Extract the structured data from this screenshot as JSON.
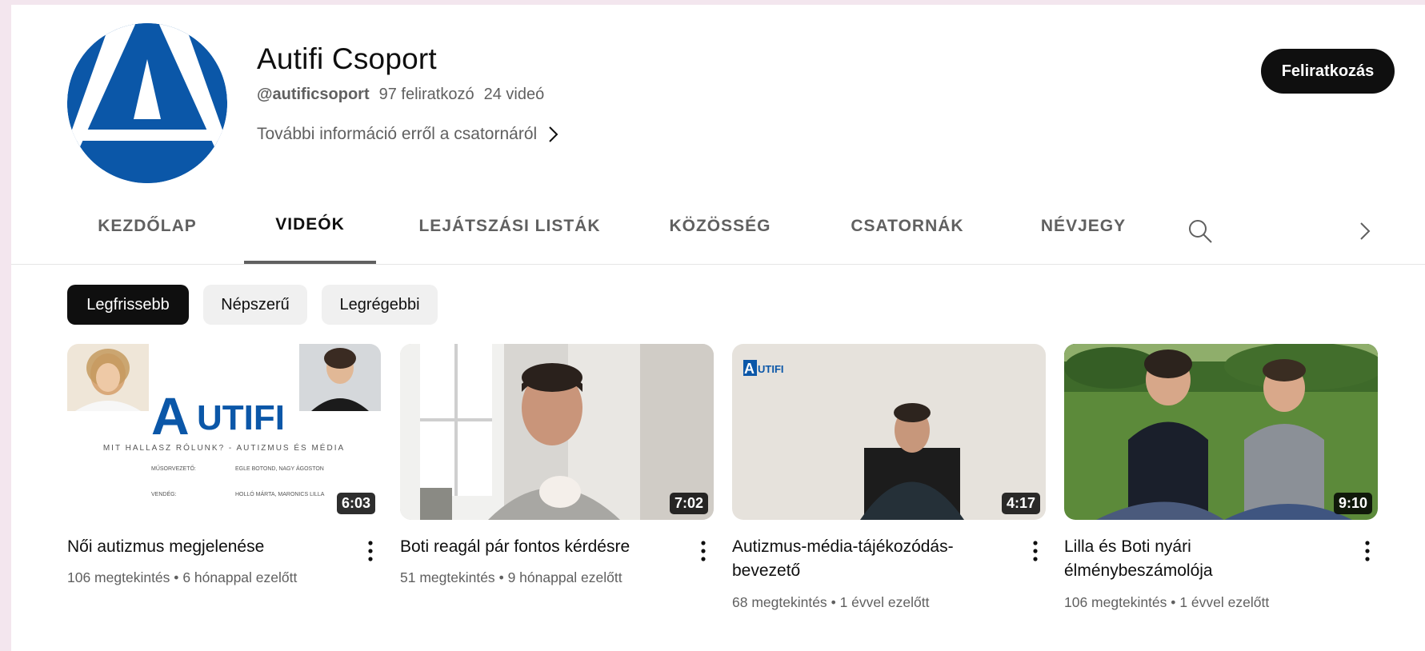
{
  "channel": {
    "name": "Autifi Csoport",
    "handle": "@autificsoport",
    "subscribers": "97 feliratkozó",
    "video_count": "24 videó",
    "about_link": "További információ erről a csatornáról",
    "subscribe_label": "Feliratkozás"
  },
  "tabs": [
    {
      "label": "KEZDŐLAP"
    },
    {
      "label": "VIDEÓK"
    },
    {
      "label": "LEJÁTSZÁSI LISTÁK"
    },
    {
      "label": "KÖZÖSSÉG"
    },
    {
      "label": "CSATORNÁK"
    },
    {
      "label": "NÉVJEGY"
    }
  ],
  "active_tab": "VIDEÓK",
  "chips": [
    {
      "label": "Legfrissebb"
    },
    {
      "label": "Népszerű"
    },
    {
      "label": "Legrégebbi"
    }
  ],
  "active_chip": "Legfrissebb",
  "videos": [
    {
      "title": "Női autizmus megjelenése",
      "duration": "6:03",
      "views": "106 megtekintés",
      "age": "6 hónappal ezelőtt",
      "thumb": {
        "logo_letter": "A",
        "logo_text": "UTIFI",
        "subtitle": "MIT HALLASZ RÓLUNK? - AUTIZMUS ÉS MÉDIA",
        "host_label": "MŰSORVEZETŐ:",
        "hosts": "EGLE BOTOND, NAGY ÁGOSTON",
        "guest_label": "VENDÉG:",
        "guests": "HOLLÓ MÁRTA, MARONICS LILLA"
      }
    },
    {
      "title": "Boti reagál pár fontos kérdésre",
      "duration": "7:02",
      "views": "51 megtekintés",
      "age": "9 hónappal ezelőtt"
    },
    {
      "title": "Autizmus-média-tájékozódás-bevezető",
      "duration": "4:17",
      "views": "68 megtekintés",
      "age": "1 évvel ezelőtt",
      "thumb": {
        "logo_letter": "A",
        "logo_text": "UTIFI"
      }
    },
    {
      "title": "Lilla és Boti nyári élménybeszámolója",
      "duration": "9:10",
      "views": "106 megtekintés",
      "age": "1 évvel ezelőtt"
    }
  ],
  "meta_separator": "•",
  "colors": {
    "brand_blue": "#0b57a8",
    "background": "#f3e6ee",
    "text_primary": "#0f0f0f",
    "text_secondary": "#606060"
  },
  "icons": [
    "channel-avatar-logo",
    "chevron-right-icon",
    "search-icon",
    "more-vert-icon"
  ]
}
